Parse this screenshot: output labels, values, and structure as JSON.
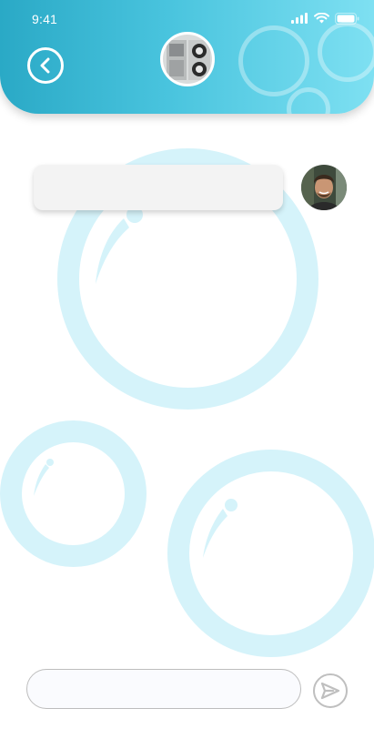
{
  "status_bar": {
    "time": "9:41",
    "icons": [
      "signal-icon",
      "wifi-icon",
      "battery-icon"
    ]
  },
  "header": {
    "back_icon": "chevron-left-icon",
    "avatar_icon": "machine-avatar"
  },
  "chat": {
    "messages": [
      {
        "text": "",
        "sender_avatar": "user-avatar"
      }
    ]
  },
  "composer": {
    "input_value": "",
    "placeholder": "",
    "send_icon": "send-icon"
  },
  "colors": {
    "header_gradient_start": "#2aa9c6",
    "header_gradient_end": "#7ee0f2",
    "bubble_decoration": "#d5f3fa",
    "message_bg": "#f3f3f3",
    "send_icon": "#bfbfbf"
  }
}
